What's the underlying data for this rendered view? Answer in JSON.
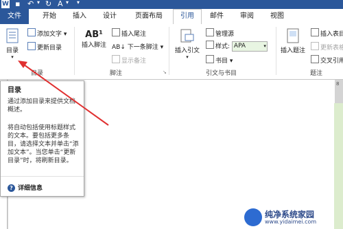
{
  "qat": {
    "app_icon": "W"
  },
  "tabs": [
    {
      "label": "文件"
    },
    {
      "label": "开始"
    },
    {
      "label": "插入"
    },
    {
      "label": "设计"
    },
    {
      "label": "页面布局"
    },
    {
      "label": "引用"
    },
    {
      "label": "邮件"
    },
    {
      "label": "审阅"
    },
    {
      "label": "视图"
    }
  ],
  "ribbon": {
    "toc_group": {
      "toc_button": "目录",
      "add_text": "添加文字",
      "update_toc": "更新目录",
      "label": "目录"
    },
    "footnote_group": {
      "insert_footnote": "插入脚注",
      "insert_endnote": "插入尾注",
      "next_footnote": "下一条脚注",
      "show_notes": "显示备注",
      "label": "脚注"
    },
    "citation_group": {
      "insert_citation": "插入引文",
      "manage_sources": "管理源",
      "style_label": "样式:",
      "style_value": "APA",
      "bibliography": "书目",
      "label": "引文与书目"
    },
    "caption_group": {
      "insert_caption": "插入题注",
      "insert_table_figures": "插入表目",
      "update_table": "更新表格",
      "cross_reference": "交叉引用",
      "label": "题注"
    }
  },
  "tooltip": {
    "title": "目录",
    "para1": "通过添加目录来提供文档概述。",
    "para2": "将自动包括使用标题样式的文本。要包括更多条目，请选择文本并单击“添加文本”。当您单击“更新目录”时，将刷新目录。",
    "more_info": "详细信息"
  },
  "ruler": {
    "number": "8"
  },
  "watermark": {
    "line1": "纯净系统家园",
    "line2": "www.yidaimei.com"
  },
  "colors": {
    "accent": "#2b579a",
    "arrow": "#e03030"
  }
}
